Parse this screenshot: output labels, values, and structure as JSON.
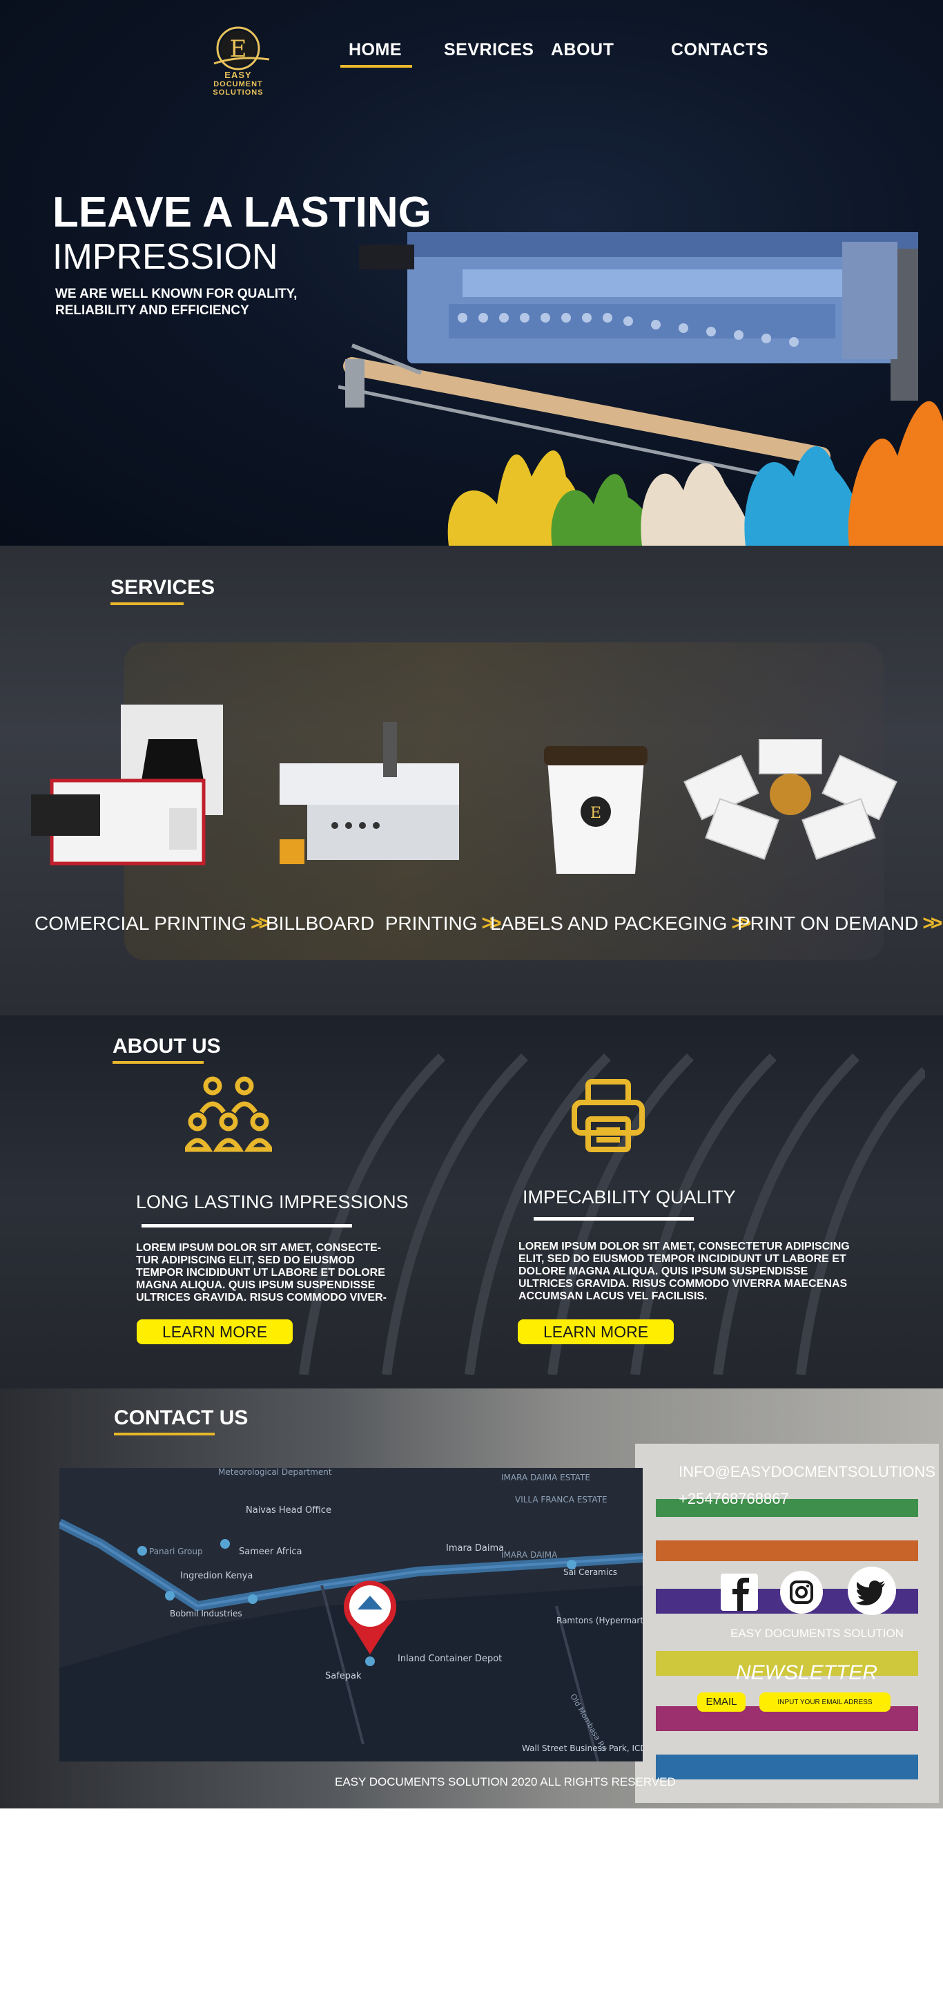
{
  "brand": {
    "logo_letter": "E",
    "name_line1": "EASY",
    "name_line2": "DOCUMENT SOLUTIONS"
  },
  "nav": {
    "items": [
      {
        "label": "HOME",
        "active": true
      },
      {
        "label": "SEVRICES",
        "active": false
      },
      {
        "label": "ABOUT",
        "active": false
      },
      {
        "label": "CONTACTS",
        "active": false
      }
    ]
  },
  "hero": {
    "title_line1": "LEAVE A LASTING",
    "title_line2": "IMPRESSION",
    "subtitle": "WE ARE WELL KNOWN FOR QUALITY, RELIABILITY AND EFFICIENCY"
  },
  "services": {
    "title": "SERVICES",
    "items": [
      {
        "label": "COMERCIAL PRINTING",
        "icon": "chevron-double-right-icon"
      },
      {
        "label": "BILLBOARD  PRINTING",
        "icon": "chevron-double-right-icon"
      },
      {
        "label": "LABELS AND PACKEGING",
        "icon": "chevron-double-right-icon"
      },
      {
        "label": "PRINT ON DEMAND",
        "icon": "chevron-double-right-icon"
      }
    ]
  },
  "about": {
    "title": "ABOUT US",
    "columns": [
      {
        "icon": "people-group-icon",
        "title": "LONG LASTING IMPRESSIONS",
        "text": "LOREM IPSUM DOLOR SIT AMET, CONSECTE-TUR ADIPISCING ELIT, SED DO EIUSMOD TEMPOR INCIDIDUNT UT LABORE ET DOLORE MAGNA ALIQUA. QUIS IPSUM SUSPENDISSE ULTRICES GRAVIDA. RISUS COMMODO VIVER-",
        "button": "LEARN MORE"
      },
      {
        "icon": "printer-icon",
        "title": "IMPECABILITY QUALITY",
        "text": "LOREM IPSUM DOLOR SIT AMET, CONSECTETUR ADIPISCING ELIT, SED DO EIUSMOD TEMPOR INCIDIDUNT UT LABORE ET DOLORE MAGNA ALIQUA. QUIS IPSUM SUSPENDISSE ULTRICES GRAVIDA. RISUS COMMODO VIVERRA MAECENAS ACCUMSAN LACUS VEL FACILISIS.",
        "button": "LEARN MORE"
      }
    ]
  },
  "contact": {
    "title": "CONTACT US",
    "email": "INFO@EASYDOCMENTSOLUTIONS",
    "phone": "+254768768867",
    "social": [
      "facebook-icon",
      "instagram-icon",
      "twitter-icon"
    ],
    "company": "EASY DOCUMENTS SOLUTION",
    "newsletter_title": "NEWSLETTER",
    "email_label": "EMAIL",
    "email_placeholder": "INPUT YOUR EMAIL ADRESS",
    "map_labels": {
      "meteorological": "Meteorological Department",
      "imara_daima_estate": "IMARA DAIMA ESTATE",
      "villa_franca": "VILLA FRANCA ESTATE",
      "naivas": "Naivas Head Office",
      "panari": "Panari Group",
      "sameer": "Sameer Africa",
      "ingredion": "Ingredion Kenya",
      "imara_daima": "Imara Daima",
      "imara_daima_road": "IMARA DAIMA",
      "sai_ceramics": "Sai Ceramics",
      "bobmil": "Bobmil Industries",
      "ramtons": "Ramtons (Hypermart LTD)",
      "inland": "Inland Container Depot",
      "safepak": "Safepak",
      "wall_street": "Wall Street Business Park, ICD",
      "mombasa_rd": "Old Mombasa Rd"
    }
  },
  "footer": {
    "text": "EASY DOCUMENTS SOLUTION 2020 ALL RIGHTS RESERVED"
  },
  "colors": {
    "accent": "#e8b72b",
    "button": "#ffee00",
    "hero_bg": "#0d1627"
  }
}
